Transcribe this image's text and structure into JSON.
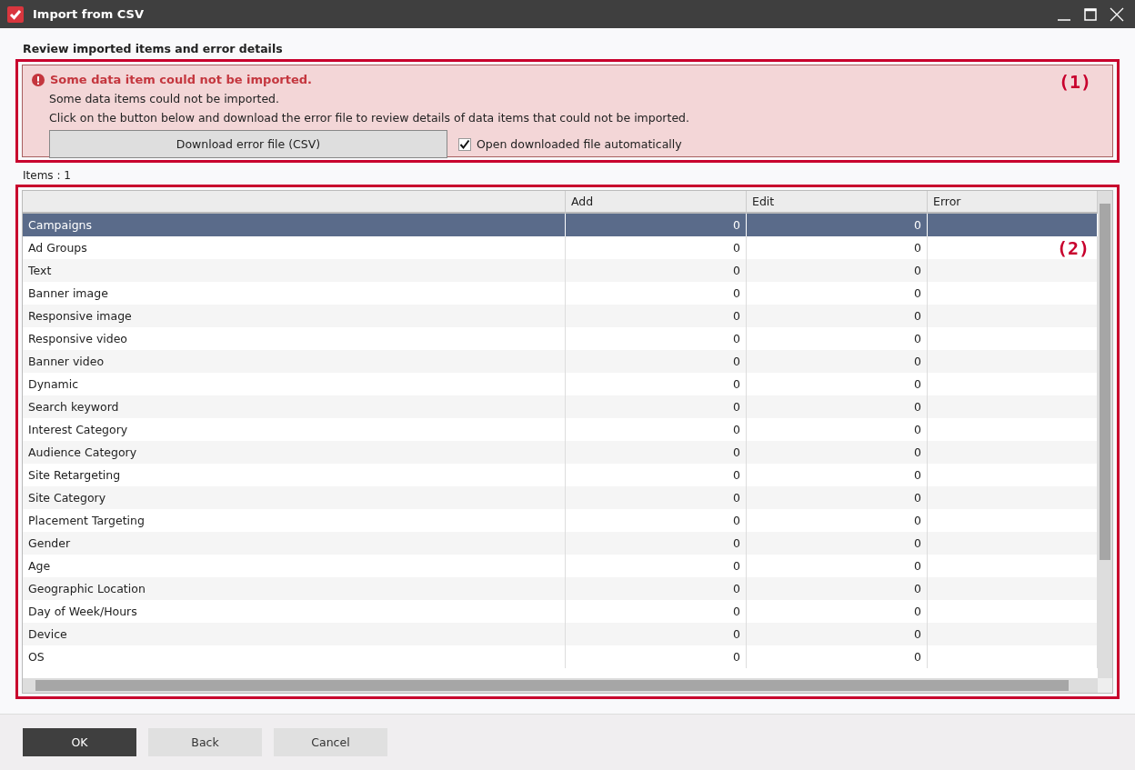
{
  "window": {
    "title": "Import from CSV"
  },
  "heading": "Review imported items and error details",
  "alert": {
    "title": "Some data item could not be imported.",
    "lines": [
      "Some data items could not be imported.",
      "Click on the button below and download the error file to review details of data items that could not be imported."
    ],
    "button": "Download error file (CSV)",
    "checkbox": {
      "label": "Open downloaded file automatically",
      "checked": true
    },
    "annotation": "(1)"
  },
  "items_count": "Items : 1",
  "table": {
    "annotation": "(2)",
    "columns": [
      "Add",
      "Edit",
      "Error"
    ],
    "rows": [
      {
        "name": "Campaigns",
        "add": "0",
        "edit": "0",
        "selected": true
      },
      {
        "name": "Ad Groups",
        "add": "0",
        "edit": "0",
        "selected": false
      },
      {
        "name": "Text",
        "add": "0",
        "edit": "0",
        "selected": false
      },
      {
        "name": "Banner image",
        "add": "0",
        "edit": "0",
        "selected": false
      },
      {
        "name": "Responsive image",
        "add": "0",
        "edit": "0",
        "selected": false
      },
      {
        "name": "Responsive video",
        "add": "0",
        "edit": "0",
        "selected": false
      },
      {
        "name": "Banner video",
        "add": "0",
        "edit": "0",
        "selected": false
      },
      {
        "name": "Dynamic",
        "add": "0",
        "edit": "0",
        "selected": false
      },
      {
        "name": "Search keyword",
        "add": "0",
        "edit": "0",
        "selected": false
      },
      {
        "name": "Interest Category",
        "add": "0",
        "edit": "0",
        "selected": false
      },
      {
        "name": "Audience Category",
        "add": "0",
        "edit": "0",
        "selected": false
      },
      {
        "name": "Site Retargeting",
        "add": "0",
        "edit": "0",
        "selected": false
      },
      {
        "name": "Site Category",
        "add": "0",
        "edit": "0",
        "selected": false
      },
      {
        "name": "Placement Targeting",
        "add": "0",
        "edit": "0",
        "selected": false
      },
      {
        "name": "Gender",
        "add": "0",
        "edit": "0",
        "selected": false
      },
      {
        "name": "Age",
        "add": "0",
        "edit": "0",
        "selected": false
      },
      {
        "name": "Geographic Location",
        "add": "0",
        "edit": "0",
        "selected": false
      },
      {
        "name": "Day of Week/Hours",
        "add": "0",
        "edit": "0",
        "selected": false
      },
      {
        "name": "Device",
        "add": "0",
        "edit": "0",
        "selected": false
      },
      {
        "name": "OS",
        "add": "0",
        "edit": "0",
        "selected": false
      }
    ]
  },
  "buttons": [
    {
      "label": "OK",
      "kind": "primary"
    },
    {
      "label": "Back",
      "kind": "secondary"
    },
    {
      "label": "Cancel",
      "kind": "secondary"
    }
  ]
}
